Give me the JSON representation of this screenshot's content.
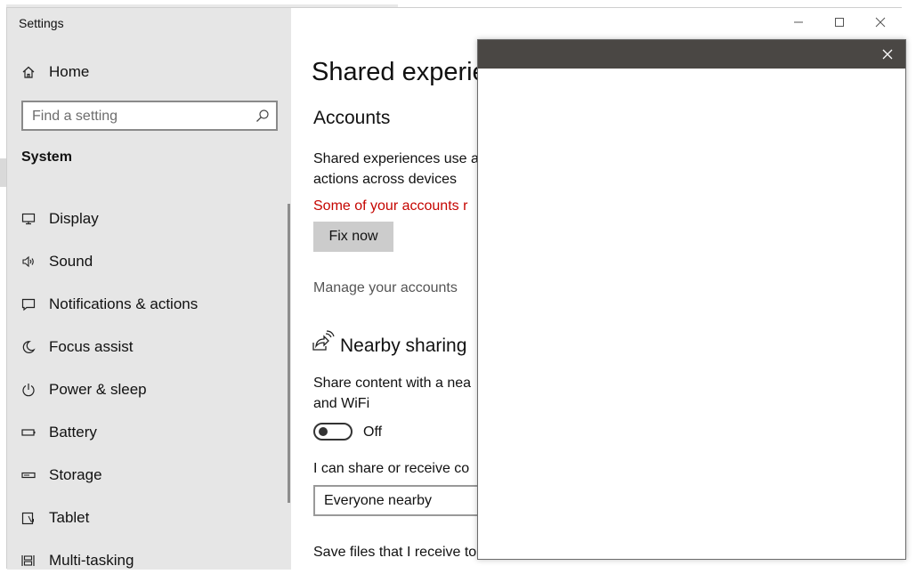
{
  "window": {
    "title": "Settings",
    "controls": [
      "minimize",
      "maximize",
      "close"
    ]
  },
  "sidebar": {
    "home_label": "Home",
    "search_placeholder": "Find a setting",
    "section_label": "System",
    "items": [
      {
        "label": "Display",
        "icon": "monitor-icon"
      },
      {
        "label": "Sound",
        "icon": "speaker-icon"
      },
      {
        "label": "Notifications & actions",
        "icon": "notification-icon"
      },
      {
        "label": "Focus assist",
        "icon": "moon-icon"
      },
      {
        "label": "Power & sleep",
        "icon": "power-icon"
      },
      {
        "label": "Battery",
        "icon": "battery-icon"
      },
      {
        "label": "Storage",
        "icon": "storage-icon"
      },
      {
        "label": "Tablet",
        "icon": "tablet-icon"
      },
      {
        "label": "Multi-tasking",
        "icon": "multitasking-icon"
      }
    ]
  },
  "content": {
    "page_title": "Shared experie",
    "accounts_heading": "Accounts",
    "accounts_desc_line1": "Shared experiences use a",
    "accounts_desc_line2": "actions across devices",
    "warning_text": "Some of your accounts r",
    "fix_button": "Fix now",
    "manage_link": "Manage your accounts",
    "nearby_heading": "Nearby sharing",
    "nearby_desc_line1": "Share content with a nea",
    "nearby_desc_line2": "and WiFi",
    "toggle_state": "Off",
    "share_receive_label": "I can share or receive co",
    "dropdown_value": "Everyone nearby",
    "save_files_label": "Save files that I receive to"
  },
  "dialog": {
    "titlebar_color": "#4a4744",
    "close_icon": "close-icon"
  },
  "colors": {
    "sidebar_bg": "#e6e6e6",
    "warning": "#c50500",
    "button_bg": "#cccccc"
  }
}
